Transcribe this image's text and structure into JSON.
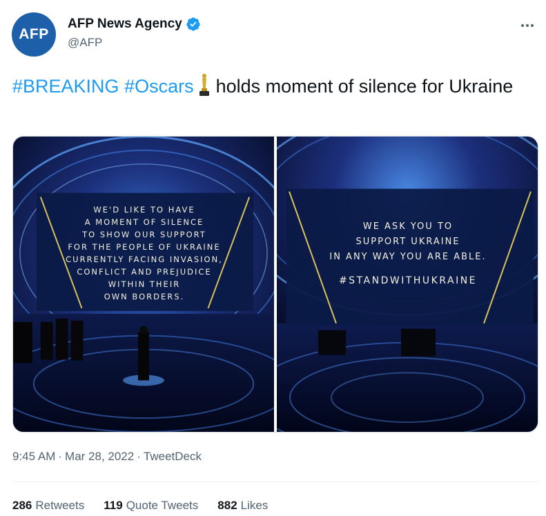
{
  "author": {
    "avatar_text": "AFP",
    "display_name": "AFP News Agency",
    "handle": "@AFP",
    "verified": true
  },
  "tweet": {
    "hashtag_1": "#BREAKING",
    "hashtag_2": "#Oscars",
    "emoji": "oscar-statuette-icon",
    "text_rest": "holds moment of silence for Ukraine"
  },
  "media": {
    "photo_1": {
      "lines": [
        "We'd like to have",
        "a moment of silence",
        "to show our support",
        "for the people of Ukraine",
        "currently facing invasion,",
        "conflict and prejudice",
        "within their",
        "own borders."
      ]
    },
    "photo_2": {
      "lines": [
        "We ask you to",
        "support Ukraine",
        "in any way you are able."
      ],
      "tag": "#StandWithUkraine"
    }
  },
  "meta": {
    "time": "9:45 AM",
    "date": "Mar 28, 2022",
    "source": "TweetDeck"
  },
  "stats": {
    "retweets_count": "286",
    "retweets_label": "Retweets",
    "quotes_count": "119",
    "quotes_label": "Quote Tweets",
    "likes_count": "882",
    "likes_label": "Likes"
  },
  "colors": {
    "link": "#1d9bf0",
    "secondary_text": "#536471",
    "avatar_bg": "#1d5fa9"
  }
}
